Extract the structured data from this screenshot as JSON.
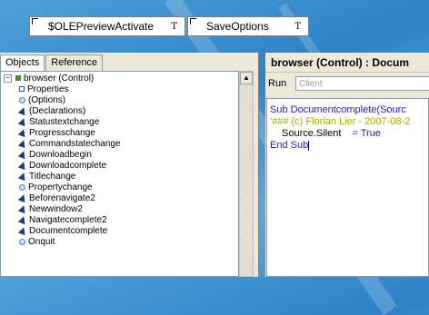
{
  "toolbar": {
    "button1_label": "$OLEPreviewActivate",
    "button2_label": "SaveOptions",
    "t_mark": "T"
  },
  "left": {
    "tabs": [
      "Objects",
      "Reference"
    ],
    "tree": {
      "root": "browser (Control)",
      "items": [
        {
          "label": "Properties",
          "icon": "property-icon"
        },
        {
          "label": "(Options)",
          "icon": "options-icon"
        },
        {
          "label": "(Declarations)",
          "icon": "event-icon"
        },
        {
          "label": "Statustextchange",
          "icon": "event-icon"
        },
        {
          "label": "Progresschange",
          "icon": "event-icon"
        },
        {
          "label": "Commandstatechange",
          "icon": "event-icon"
        },
        {
          "label": "Downloadbegin",
          "icon": "event-icon"
        },
        {
          "label": "Downloadcomplete",
          "icon": "event-icon"
        },
        {
          "label": "Titlechange",
          "icon": "event-icon"
        },
        {
          "label": "Propertychange",
          "icon": "options-icon"
        },
        {
          "label": "Beforenavigate2",
          "icon": "event-icon"
        },
        {
          "label": "Newwindow2",
          "icon": "event-icon"
        },
        {
          "label": "Navigatecomplete2",
          "icon": "event-icon"
        },
        {
          "label": "Documentcomplete",
          "icon": "event-icon"
        },
        {
          "label": "Onquit",
          "icon": "options-icon"
        }
      ]
    },
    "scroll_up": "▲"
  },
  "right": {
    "title": "browser (Control) : Docum",
    "run_label": "Run",
    "client_placeholder": "Client",
    "code": {
      "line1_kw": "Sub ",
      "line1_rest": "Documentcomplete(Sourc",
      "line2": "'### (c) Florian Lier - 2007-08-2",
      "line3_a": "Source.Silent",
      "line3_b": "= True",
      "line4": "End Sub"
    }
  }
}
